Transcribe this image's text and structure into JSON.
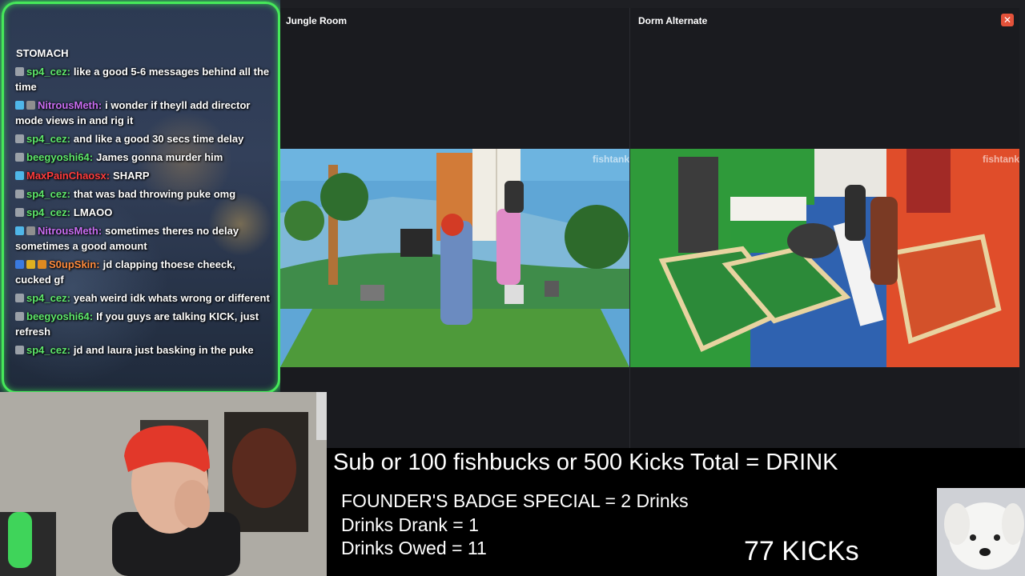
{
  "chat": {
    "header": "STOMACH",
    "messages": [
      {
        "user": "sp4_cez",
        "color": "#5ee86a",
        "text": "like a good 5-6 messages behind all the time",
        "badges": [
          "#9aa0a8"
        ]
      },
      {
        "user": "NitrousMeth",
        "color": "#c86cf0",
        "text": "i wonder if theyll add director mode views in and rig it",
        "badges": [
          "#4fb6e8",
          "#8f8f8f"
        ]
      },
      {
        "user": "sp4_cez",
        "color": "#5ee86a",
        "text": "and like a good 30 secs time delay",
        "badges": [
          "#9aa0a8"
        ]
      },
      {
        "user": "beegyoshi64",
        "color": "#5ee86a",
        "text": "James gonna murder him",
        "badges": [
          "#9aa0a8"
        ]
      },
      {
        "user": "MaxPainChaosx",
        "color": "#ff3b3b",
        "text": "SHARP",
        "badges": [
          "#4fb6e8"
        ]
      },
      {
        "user": "sp4_cez",
        "color": "#5ee86a",
        "text": "that was bad throwing puke omg",
        "badges": [
          "#9aa0a8"
        ]
      },
      {
        "user": "sp4_cez",
        "color": "#5ee86a",
        "text": "LMAOO",
        "badges": [
          "#9aa0a8"
        ]
      },
      {
        "user": "NitrousMeth",
        "color": "#c86cf0",
        "text": "sometimes theres no delay sometimes a good amount",
        "badges": [
          "#4fb6e8",
          "#8f8f8f"
        ]
      },
      {
        "user": "S0upSkin",
        "color": "#ff8a3b",
        "text": "jd clapping thoese cheeck, cucked gf",
        "badges": [
          "#3a7ae0",
          "#e0b020",
          "#e08a20"
        ]
      },
      {
        "user": "sp4_cez",
        "color": "#5ee86a",
        "text": "yeah weird idk whats wrong or different",
        "badges": [
          "#9aa0a8"
        ]
      },
      {
        "user": "beegyoshi64",
        "color": "#5ee86a",
        "text": "If you guys are talking KICK, just refresh",
        "badges": [
          "#9aa0a8"
        ]
      },
      {
        "user": "sp4_cez",
        "color": "#5ee86a",
        "text": "jd and laura just basking in the puke",
        "badges": [
          "#9aa0a8"
        ]
      }
    ]
  },
  "cameras": {
    "left": {
      "title": "Jungle Room",
      "watermark": "fishtank"
    },
    "right": {
      "title": "Dorm Alternate",
      "watermark": "fishtank",
      "close_label": "✕"
    }
  },
  "info": {
    "headline": "Sub or 100 fishbucks or 500 Kicks Total = DRINK",
    "special": "FOUNDER'S BADGE SPECIAL = 2 Drinks",
    "drank": "Drinks Drank = 1",
    "owed": "Drinks Owed = 11",
    "kicks": "77 KICKs"
  }
}
